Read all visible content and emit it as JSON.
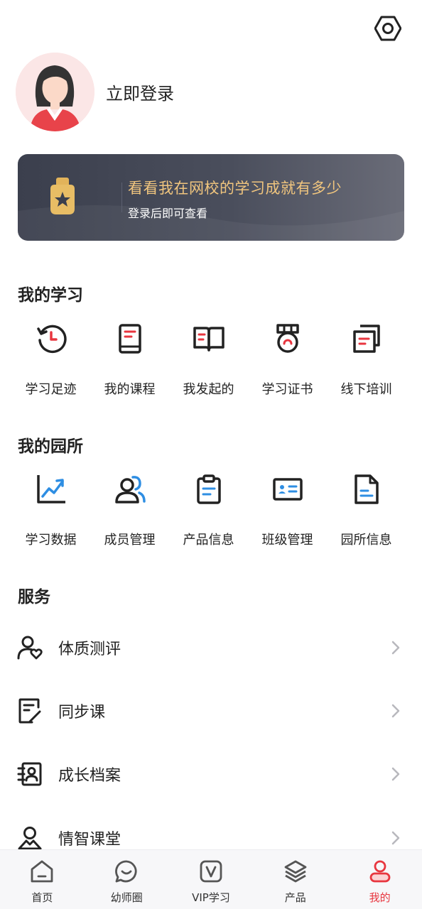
{
  "header": {
    "settings_icon": "settings-hexagon-icon"
  },
  "profile": {
    "login_text": "立即登录",
    "avatar_icon": "user-avatar-icon"
  },
  "banner": {
    "title": "看看我在网校的学习成就有多少",
    "subtitle": "登录后即可查看",
    "icon": "medal-icon",
    "title_color": "#f0c57e"
  },
  "my_study": {
    "title": "我的学习",
    "items": [
      {
        "label": "学习足迹",
        "icon": "history-clock-icon"
      },
      {
        "label": "我的课程",
        "icon": "book-icon"
      },
      {
        "label": "我发起的",
        "icon": "open-book-icon"
      },
      {
        "label": "学习证书",
        "icon": "certificate-medal-icon"
      },
      {
        "label": "线下培训",
        "icon": "copy-documents-icon"
      }
    ]
  },
  "my_kindergarten": {
    "title": "我的园所",
    "items": [
      {
        "label": "学习数据",
        "icon": "trend-chart-icon"
      },
      {
        "label": "成员管理",
        "icon": "members-icon"
      },
      {
        "label": "产品信息",
        "icon": "clipboard-icon"
      },
      {
        "label": "班级管理",
        "icon": "id-card-icon"
      },
      {
        "label": "园所信息",
        "icon": "file-icon"
      }
    ]
  },
  "services": {
    "title": "服务",
    "items": [
      {
        "label": "体质测评",
        "icon": "user-heart-icon"
      },
      {
        "label": "同步课",
        "icon": "edit-document-icon"
      },
      {
        "label": "成长档案",
        "icon": "contact-book-icon"
      },
      {
        "label": "情智课堂",
        "icon": "user-mountain-icon"
      }
    ]
  },
  "tabbar": {
    "tabs": [
      {
        "label": "首页",
        "icon": "home-icon"
      },
      {
        "label": "幼师圈",
        "icon": "chat-bubble-icon"
      },
      {
        "label": "VIP学习",
        "icon": "vip-icon"
      },
      {
        "label": "产品",
        "icon": "layers-icon"
      },
      {
        "label": "我的",
        "icon": "profile-icon",
        "active": true
      }
    ],
    "active_color": "#e8363f"
  }
}
